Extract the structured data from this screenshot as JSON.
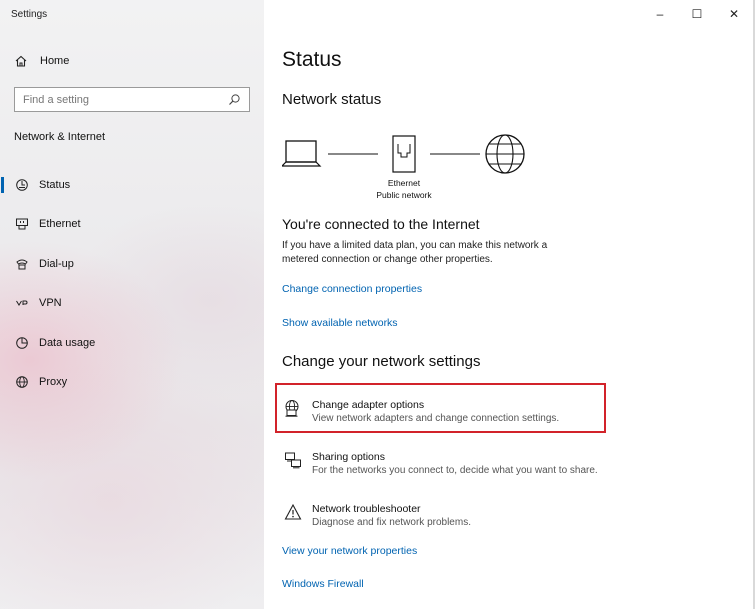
{
  "window": {
    "title": "Settings",
    "minimize": "–",
    "maximize": "☐",
    "close": "✕"
  },
  "sidebar": {
    "home_label": "Home",
    "search": {
      "placeholder": "Find a setting"
    },
    "section_title": "Network & Internet",
    "items": [
      {
        "label": "Status",
        "icon": "status-icon",
        "active": true
      },
      {
        "label": "Ethernet",
        "icon": "ethernet-icon"
      },
      {
        "label": "Dial-up",
        "icon": "dial-up-icon"
      },
      {
        "label": "VPN",
        "icon": "vpn-icon"
      },
      {
        "label": "Data usage",
        "icon": "data-usage-icon"
      },
      {
        "label": "Proxy",
        "icon": "proxy-icon"
      }
    ]
  },
  "main": {
    "title": "Status",
    "network_status_heading": "Network status",
    "diagram": {
      "adapter_label": "Ethernet",
      "network_label": "Public network"
    },
    "connected_heading": "You're connected to the Internet",
    "connected_desc_line1": "If you have a limited data plan, you can make this network a",
    "connected_desc_line2": "metered connection or change other properties.",
    "link_change_connection": "Change connection properties",
    "link_show_networks": "Show available networks",
    "change_settings_heading": "Change your network settings",
    "options": [
      {
        "title": "Change adapter options",
        "desc": "View network adapters and change connection settings.",
        "icon": "adapter-icon"
      },
      {
        "title": "Sharing options",
        "desc": "For the networks you connect to, decide what you want to share.",
        "icon": "sharing-icon"
      },
      {
        "title": "Network troubleshooter",
        "desc": "Diagnose and fix network problems.",
        "icon": "warning-icon"
      }
    ],
    "link_view_properties": "View your network properties",
    "link_firewall": "Windows Firewall"
  },
  "colors": {
    "accent": "#0063b1",
    "highlight_border": "#d2232a"
  }
}
